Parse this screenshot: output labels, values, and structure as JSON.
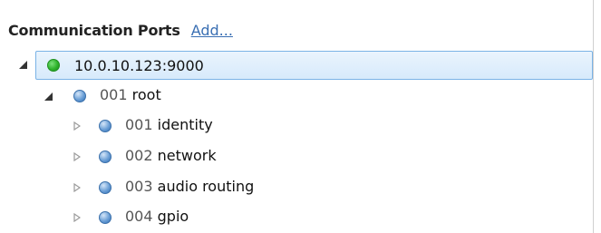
{
  "header": {
    "title": "Communication Ports",
    "add_label": "Add..."
  },
  "tree": {
    "connection": {
      "label": "10.0.10.123:9000",
      "status_color": "#2fb32c",
      "expanded": true
    },
    "root": {
      "num": "001",
      "name": "root",
      "expanded": true
    },
    "children": [
      {
        "num": "001",
        "name": "identity"
      },
      {
        "num": "002",
        "name": "network"
      },
      {
        "num": "003",
        "name": "audio routing"
      },
      {
        "num": "004",
        "name": "gpio"
      }
    ]
  },
  "colors": {
    "accent": "#3a6fb3",
    "selection_border": "#7ab3e6",
    "node_blue": "#6b9fd6"
  }
}
